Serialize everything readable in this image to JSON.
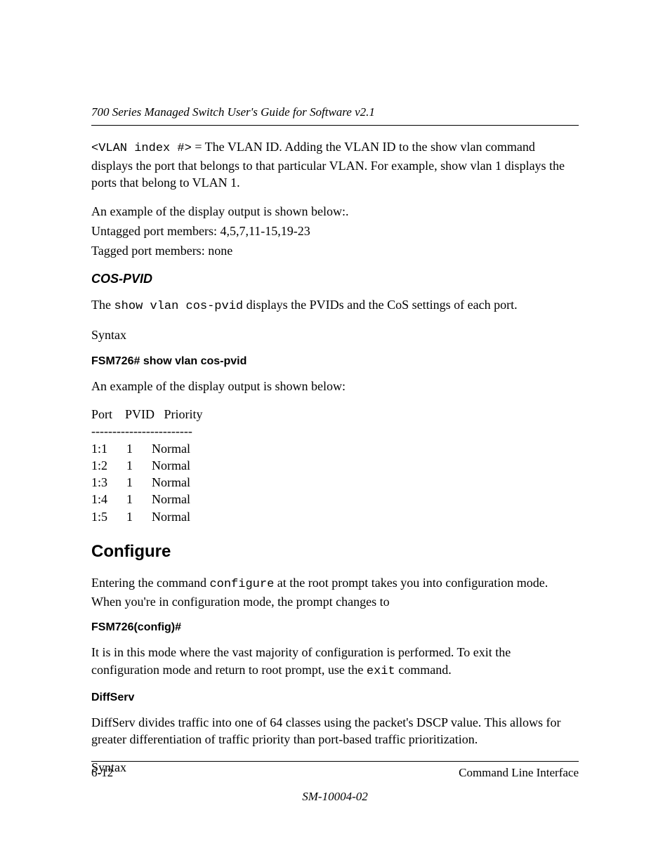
{
  "header": {
    "title": "700 Series Managed Switch User's Guide for Software v2.1"
  },
  "body": {
    "vlan_index_code": "<VLAN index #>",
    "vlan_index_text": " = The VLAN ID. Adding the VLAN ID to the show vlan command displays the port that belongs to that particular VLAN. For example, show vlan 1 displays the ports that belong to VLAN 1.",
    "example_line": "An example of the display output is shown below:.",
    "untagged_line": "Untagged port members: 4,5,7,11-15,19-23",
    "tagged_line": "Tagged port members: none",
    "cos_pvid_heading": "COS-PVID",
    "cos_pvid_intro_pre": "The ",
    "cos_pvid_cmd": "show vlan cos-pvid",
    "cos_pvid_intro_post": " displays the PVIDs and the CoS settings of each port.",
    "syntax1": "Syntax",
    "cos_pvid_syntax_cmd": "FSM726# show vlan cos-pvid",
    "cos_pvid_example_intro": "An example of the display output is shown below:",
    "table_header": "Port    PVID   Priority",
    "table_sep": "------------------------",
    "table_rows": [
      "1:1      1      Normal",
      "1:2      1      Normal",
      "1:3      1      Normal",
      "1:4      1      Normal",
      "1:5      1      Normal"
    ],
    "configure_heading": "Configure",
    "configure_intro_pre": "Entering the command ",
    "configure_cmd": "configure",
    "configure_intro_post": " at the root prompt takes you into configuration mode. When you're in configuration mode, the prompt changes to",
    "config_prompt": "FSM726(config)#",
    "config_mode_pre": "It is in this mode where the vast majority of configuration is performed. To exit the configuration mode and return to root prompt, use the ",
    "exit_cmd": "exit",
    "config_mode_post": " command.",
    "diffserv_heading": "DiffServ",
    "diffserv_text": "DiffServ divides traffic into one of 64 classes using the packet's DSCP value. This allows for greater differentiation of traffic priority than port-based traffic prioritization.",
    "syntax2": "Syntax"
  },
  "footer": {
    "page_num": "6-12",
    "section": "Command Line Interface",
    "doc_id": "SM-10004-02"
  }
}
